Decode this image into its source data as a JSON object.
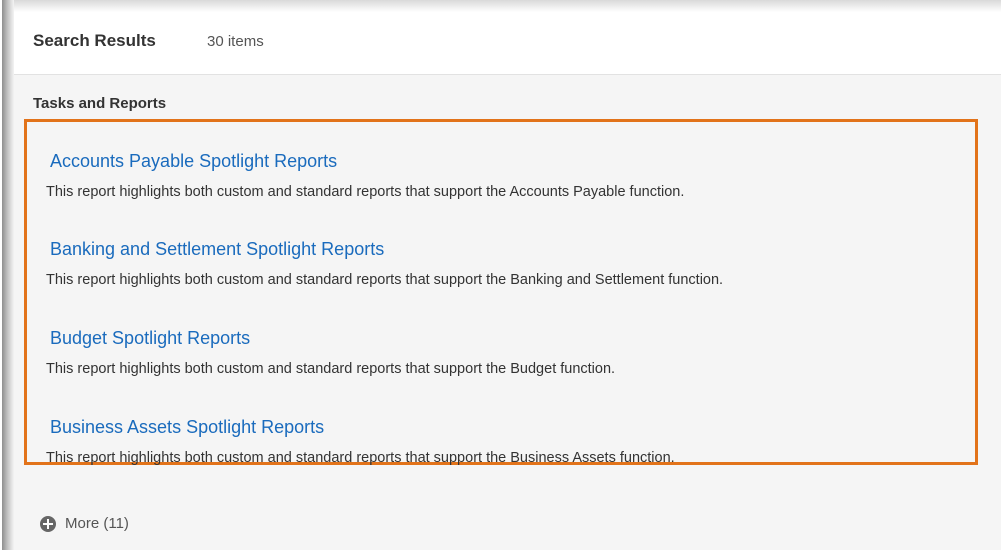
{
  "header": {
    "title": "Search Results",
    "count": "30 items"
  },
  "section": {
    "title": "Tasks and Reports"
  },
  "results": [
    {
      "title": "Accounts Payable Spotlight Reports",
      "description": "This report highlights both custom and standard reports that support the Accounts Payable function."
    },
    {
      "title": "Banking and Settlement Spotlight Reports",
      "description": "This report highlights both custom and standard reports that support the Banking and Settlement function."
    },
    {
      "title": "Budget Spotlight Reports",
      "description": "This report highlights both custom and standard reports that support the Budget function."
    },
    {
      "title": "Business Assets Spotlight Reports",
      "description": "This report highlights both custom and standard reports that support the Business Assets function."
    }
  ],
  "more": {
    "icon": "plus-circle-icon",
    "label": "More (11)"
  },
  "colors": {
    "highlight_border": "#e2731a",
    "link": "#1a6bbd"
  }
}
